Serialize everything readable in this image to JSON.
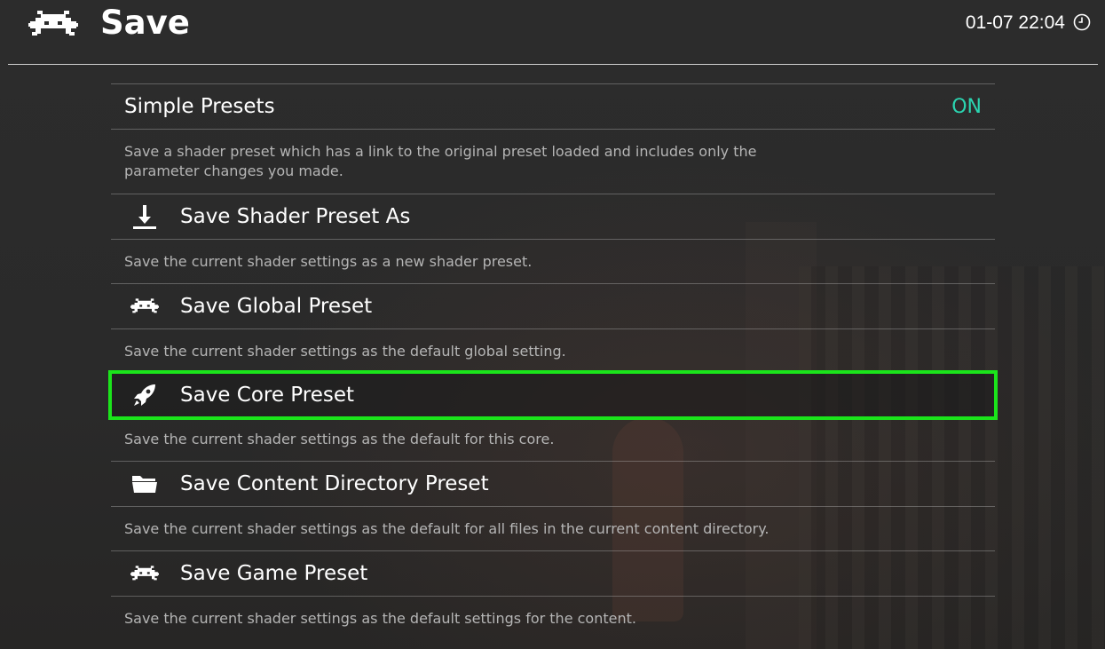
{
  "header": {
    "title": "Save",
    "clock": "01-07 22:04",
    "logo_icon": "retroarch-invader-icon",
    "clock_icon": "clock-icon"
  },
  "colors": {
    "on_value": "#2bd4b0",
    "selection": "#1be41b"
  },
  "menu": {
    "items": [
      {
        "label": "Simple Presets",
        "value": "ON",
        "icon": null,
        "description": "Save a shader preset which has a link to the original preset loaded and includes only the parameter changes you made."
      },
      {
        "label": "Save Shader Preset As",
        "icon": "download-icon",
        "description": "Save the current shader settings as a new shader preset."
      },
      {
        "label": "Save Global Preset",
        "icon": "retroarch-invader-icon",
        "description": "Save the current shader settings as the default global setting."
      },
      {
        "label": "Save Core Preset",
        "icon": "rocket-icon",
        "selected": true,
        "description": "Save the current shader settings as the default for this core."
      },
      {
        "label": "Save Content Directory Preset",
        "icon": "folder-icon",
        "description": "Save the current shader settings as the default for all files in the current content directory."
      },
      {
        "label": "Save Game Preset",
        "icon": "retroarch-invader-icon",
        "description": "Save the current shader settings as the default settings for the content."
      }
    ]
  }
}
